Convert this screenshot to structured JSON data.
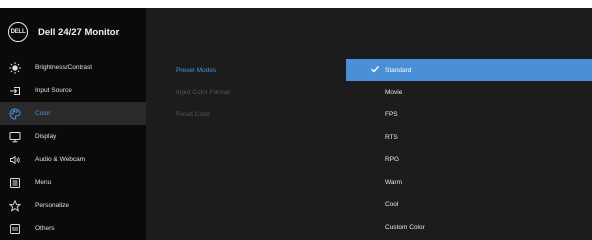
{
  "header": {
    "logo_text": "DELL",
    "title": "Dell 24/27 Monitor"
  },
  "sidebar": {
    "items": [
      {
        "label": "Brightness/Contrast",
        "icon": "brightness-icon"
      },
      {
        "label": "Input Source",
        "icon": "input-source-icon"
      },
      {
        "label": "Color",
        "icon": "color-palette-icon"
      },
      {
        "label": "Display",
        "icon": "display-icon"
      },
      {
        "label": "Audio & Webcam",
        "icon": "speaker-icon"
      },
      {
        "label": "Menu",
        "icon": "menu-icon"
      },
      {
        "label": "Personalize",
        "icon": "star-icon"
      },
      {
        "label": "Others",
        "icon": "others-icon"
      }
    ],
    "active_index": 2
  },
  "submenu": {
    "items": [
      {
        "label": "Preset Modes"
      },
      {
        "label": "Input Color Format"
      },
      {
        "label": "Reset Color"
      }
    ]
  },
  "options": {
    "items": [
      {
        "label": "Standard"
      },
      {
        "label": "Movie"
      },
      {
        "label": "FPS"
      },
      {
        "label": "RTS"
      },
      {
        "label": "RPG"
      },
      {
        "label": "Warm"
      },
      {
        "label": "Cool"
      },
      {
        "label": "Custom Color"
      }
    ],
    "selected_label": "Standard"
  },
  "colors": {
    "accent": "#4a90d9",
    "background": "#1c1c1c",
    "sidebar_background": "#0a0a0a"
  }
}
